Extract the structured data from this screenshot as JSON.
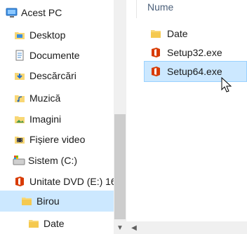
{
  "nav": {
    "items": [
      {
        "label": "Acest PC",
        "icon": "computer-icon"
      },
      {
        "label": "Desktop",
        "icon": "desktop-folder-icon"
      },
      {
        "label": "Documente",
        "icon": "documents-folder-icon"
      },
      {
        "label": "Descărcări",
        "icon": "downloads-folder-icon"
      },
      {
        "label": "Muzică",
        "icon": "music-folder-icon"
      },
      {
        "label": "Imagini",
        "icon": "pictures-folder-icon"
      },
      {
        "label": "Fișiere video",
        "icon": "videos-folder-icon"
      },
      {
        "label": "Sistem (C:)",
        "icon": "drive-c-icon"
      },
      {
        "label": "Unitate DVD (E:) 16",
        "icon": "office-dvd-icon"
      },
      {
        "label": "Birou",
        "icon": "folder-icon",
        "selected": true
      },
      {
        "label": "Date",
        "icon": "folder-icon"
      }
    ]
  },
  "content": {
    "column_header": "Nume",
    "files": [
      {
        "name": "Date",
        "icon": "folder-icon"
      },
      {
        "name": "Setup32.exe",
        "icon": "office-setup-icon"
      },
      {
        "name": "Setup64.exe",
        "icon": "office-setup-icon",
        "selected": true
      }
    ]
  },
  "colors": {
    "selection": "#cce8ff",
    "folder": "#f8d775",
    "office": "#d83b01",
    "header_text": "#4c607a"
  }
}
